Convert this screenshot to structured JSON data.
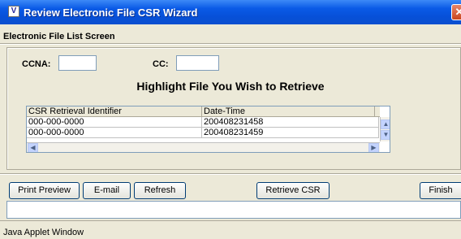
{
  "window": {
    "title": "Review Electronic File CSR Wizard",
    "icon": "app-logo-icon",
    "icon_glyph": "V",
    "close_glyph": "✕"
  },
  "screen_title": "Electronic File List Screen",
  "form": {
    "ccna_label": "CCNA:",
    "ccna_value": "",
    "cc_label": "CC:",
    "cc_value": ""
  },
  "heading": "Highlight File You Wish to Retrieve",
  "table": {
    "columns": [
      "CSR Retrieval Identifier",
      "Date-Time"
    ],
    "rows": [
      [
        "000-000-0000",
        "200408231458"
      ],
      [
        "000-000-0000",
        "200408231459"
      ]
    ],
    "scroll_up_glyph": "▲",
    "scroll_down_glyph": "▼",
    "scroll_left_glyph": "◀",
    "scroll_right_glyph": "▶"
  },
  "buttons": {
    "print_preview": "Print Preview",
    "email": "E-mail",
    "refresh": "Refresh",
    "retrieve_csr": "Retrieve CSR",
    "finish": "Finish"
  },
  "status_text": "Java Applet Window",
  "colors": {
    "titlebar": "#0a5ae6",
    "background": "#ece9d8",
    "close_button": "#c9461f"
  }
}
